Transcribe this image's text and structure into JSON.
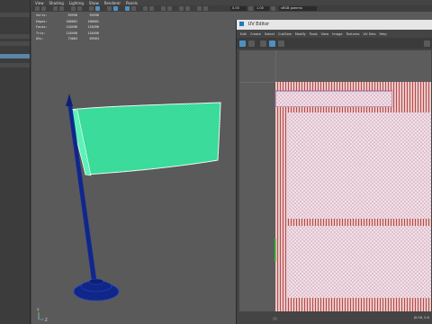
{
  "viewport": {
    "menu": [
      "View",
      "Shading",
      "Lighting",
      "Show",
      "Renderer",
      "Panels"
    ],
    "toolbar": {
      "field_value_1": "0.00",
      "field_value_2": "1.00",
      "color_space": "sRGB gamma"
    },
    "stats": [
      {
        "label": "Verts:",
        "a": "59596",
        "b": "59596"
      },
      {
        "label": "Edges:",
        "a": "180601",
        "b": "180601"
      },
      {
        "label": "Faces:",
        "a": "118496",
        "b": "118496"
      },
      {
        "label": "Tris:",
        "a": "118496",
        "b": "118496"
      },
      {
        "label": "UVs:",
        "a": "73003",
        "b": "69563"
      }
    ],
    "axis_labels": {
      "y": "Y",
      "z": "Z"
    },
    "colors": {
      "flag": "#3fe0a0",
      "pole": "#0a1f7a",
      "wire": "#ffffff",
      "background": "#5a5a5a"
    }
  },
  "uv_editor": {
    "title": "UV Editor",
    "menu": [
      "Edit",
      "Create",
      "Select",
      "Cut/Sew",
      "Modify",
      "Tools",
      "View",
      "Image",
      "Textures",
      "UV Sets",
      "Help"
    ],
    "status": "(0.00, 0.0"
  },
  "left_panel": {
    "selected_row_color": "#5a86a8"
  }
}
